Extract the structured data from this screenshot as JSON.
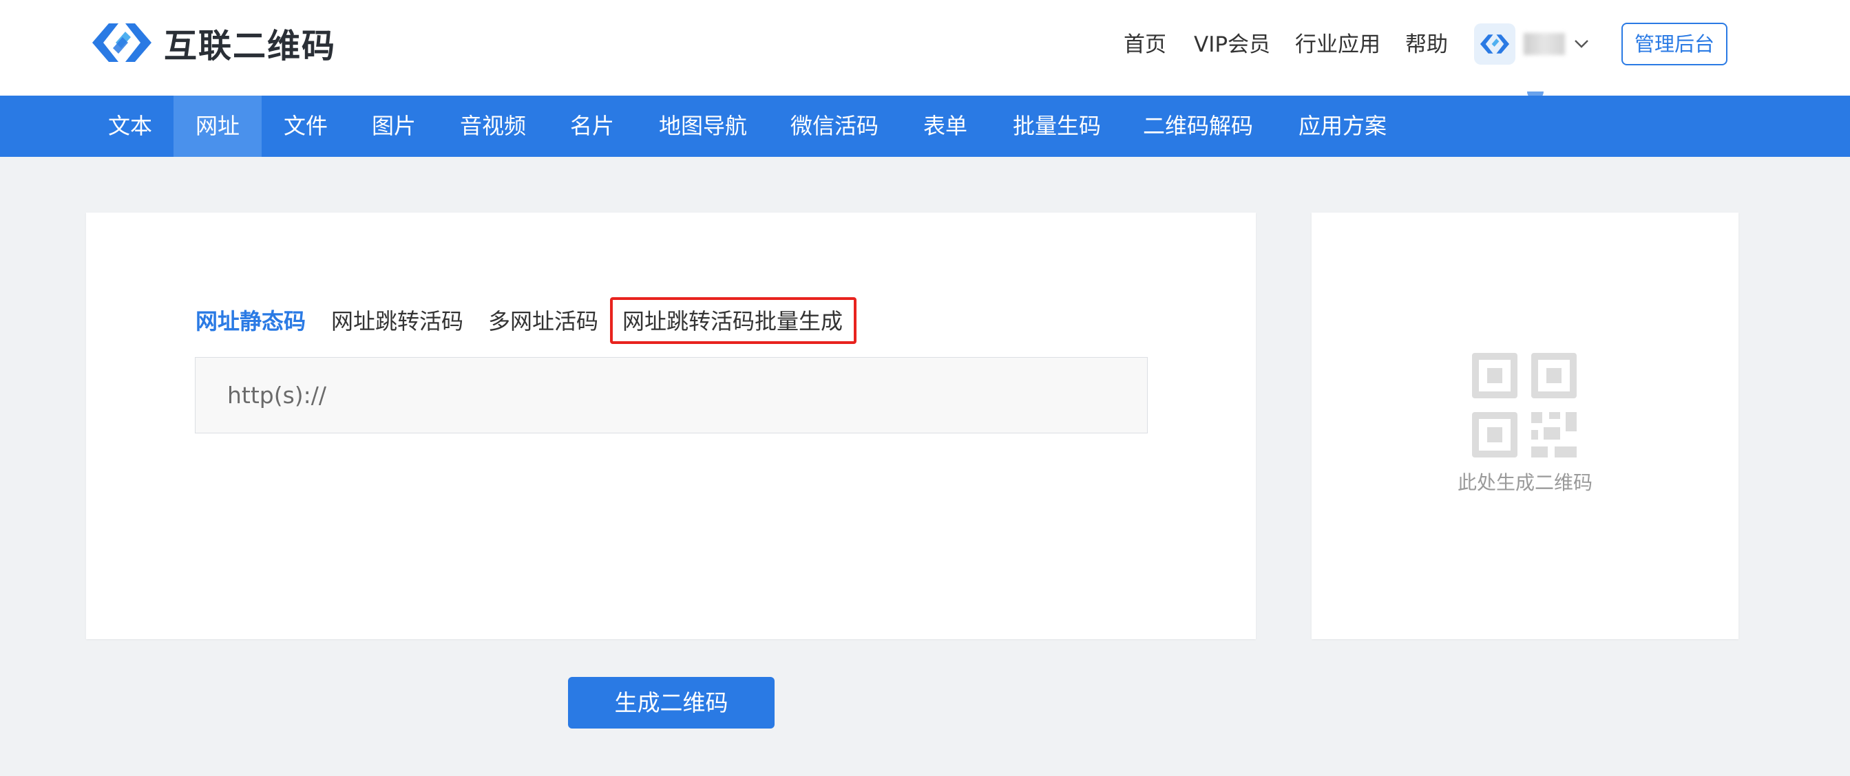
{
  "brand": {
    "name": "互联二维码"
  },
  "top_nav": [
    {
      "label": "首页"
    },
    {
      "label": "VIP会员"
    },
    {
      "label": "行业应用"
    },
    {
      "label": "帮助"
    }
  ],
  "admin_button": "管理后台",
  "main_nav": [
    {
      "label": "文本",
      "active": false
    },
    {
      "label": "网址",
      "active": true
    },
    {
      "label": "文件",
      "active": false
    },
    {
      "label": "图片",
      "active": false
    },
    {
      "label": "音视频",
      "active": false
    },
    {
      "label": "名片",
      "active": false
    },
    {
      "label": "地图导航",
      "active": false
    },
    {
      "label": "微信活码",
      "active": false
    },
    {
      "label": "表单",
      "active": false
    },
    {
      "label": "批量生码",
      "active": false
    },
    {
      "label": "二维码解码",
      "active": false
    },
    {
      "label": "应用方案",
      "active": false
    }
  ],
  "url_tabs": [
    {
      "label": "网址静态码",
      "active": true
    },
    {
      "label": "网址跳转活码",
      "active": false
    },
    {
      "label": "多网址活码",
      "active": false
    },
    {
      "label": "网址跳转活码批量生成",
      "active": false,
      "highlighted": true
    }
  ],
  "url_input": {
    "placeholder": "http(s)://",
    "value": ""
  },
  "qr_preview": {
    "caption": "此处生成二维码",
    "icon": "qr-code-icon"
  },
  "generate_button": "生成二维码",
  "colors": {
    "primary": "#2a7ae4",
    "highlight": "#e8231e",
    "background": "#f0f2f4"
  }
}
